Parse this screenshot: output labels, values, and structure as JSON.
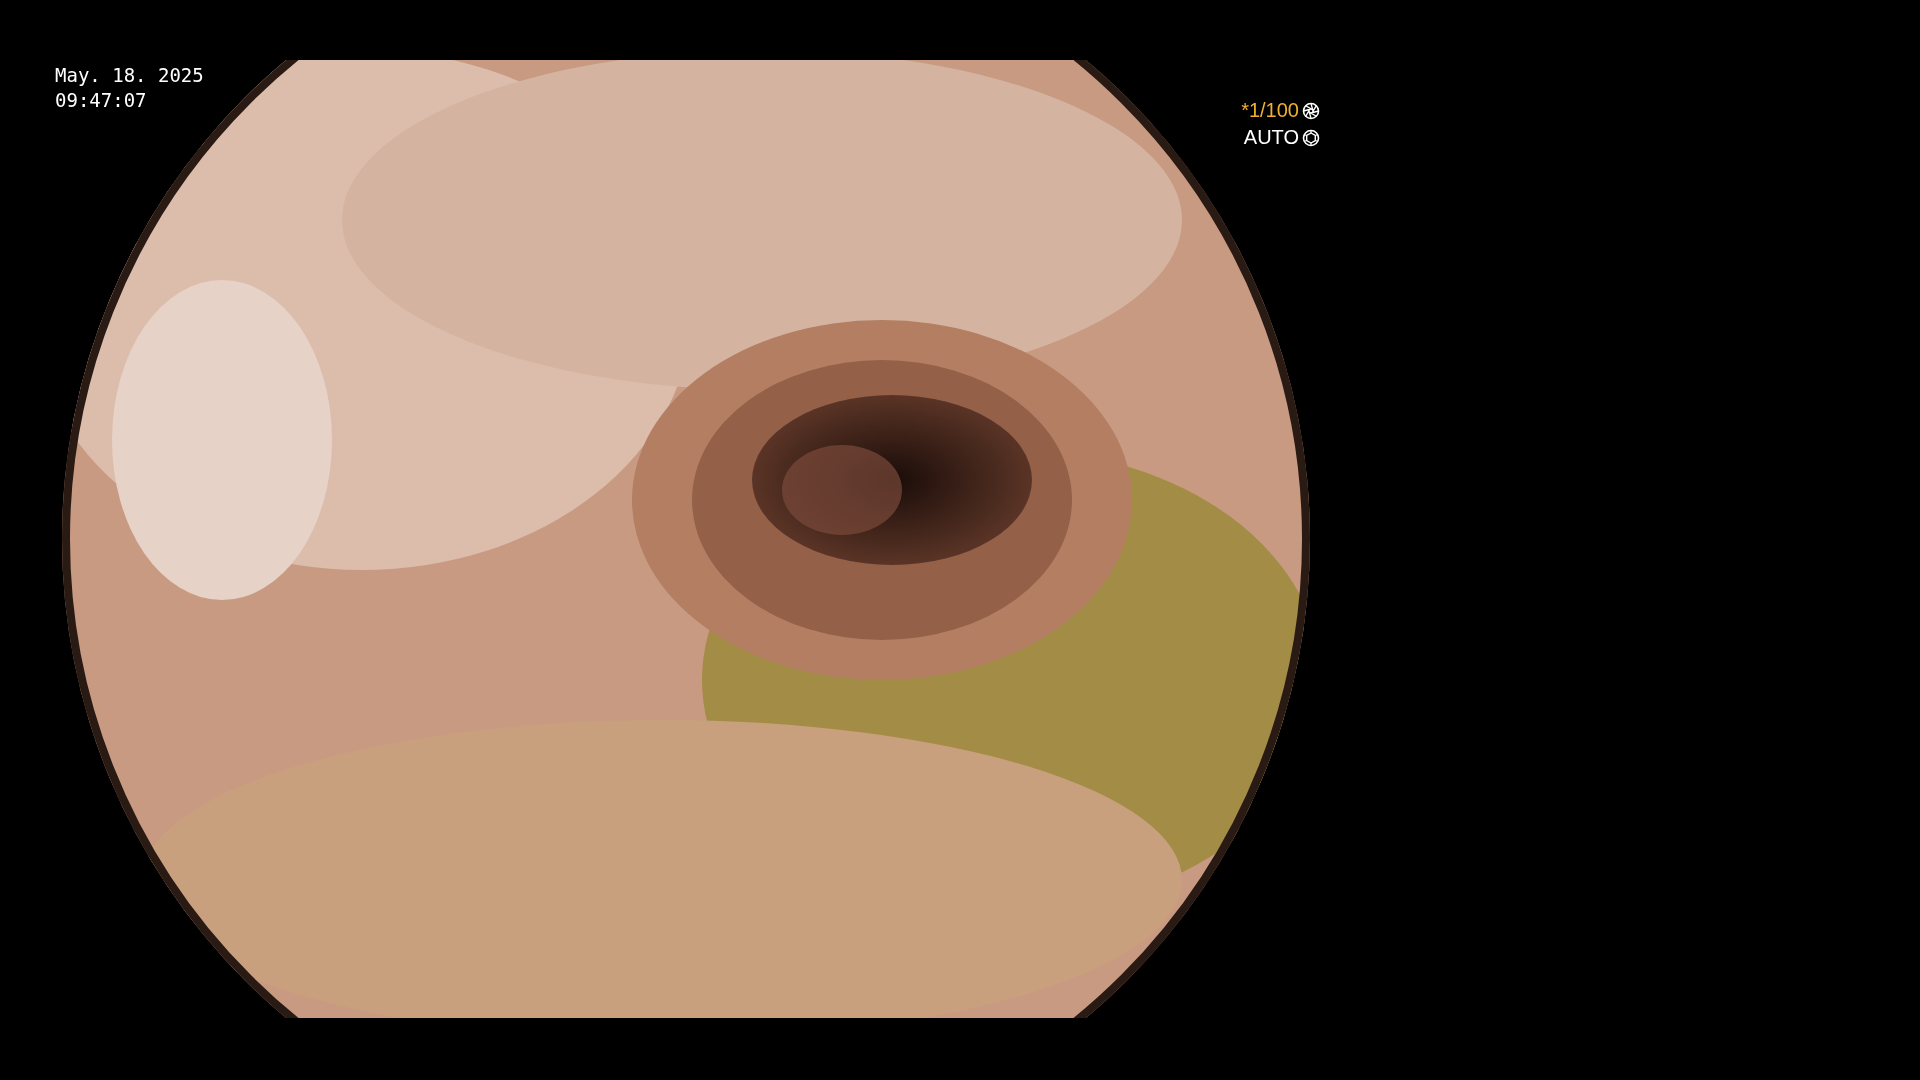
{
  "date": "May. 18. 2025",
  "time": "09:47:07",
  "shutter": "*1/100",
  "iris": "AUTO"
}
